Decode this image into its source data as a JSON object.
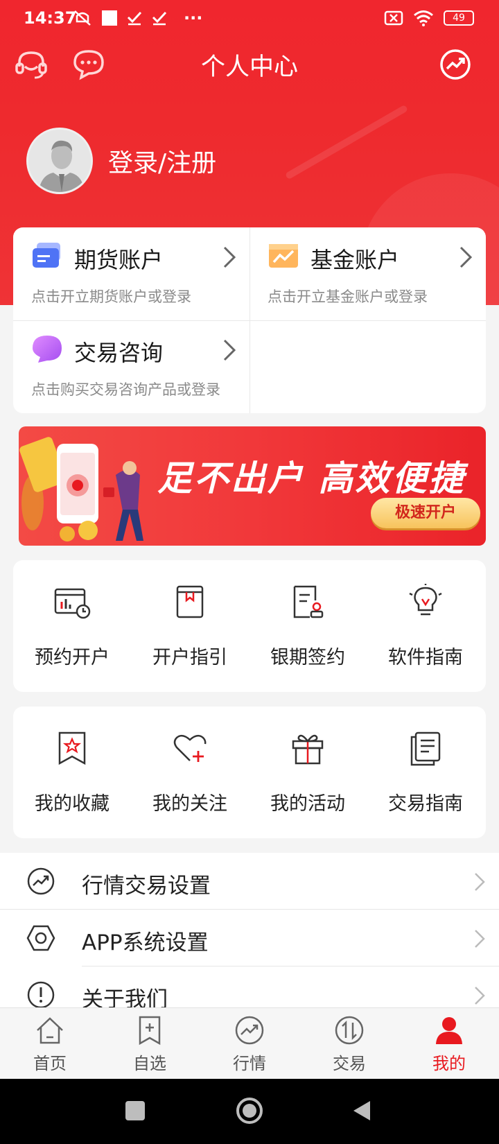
{
  "status_bar": {
    "time": "14:37",
    "dots": "···",
    "battery": "49"
  },
  "header": {
    "title": "个人中心",
    "left_icons": [
      "headset-icon",
      "chat-icon"
    ],
    "right_icon": "market-trend-icon"
  },
  "user": {
    "login_label": "登录/注册"
  },
  "accounts": [
    {
      "name": "期货账户",
      "desc": "点击开立期货账户或登录",
      "icon": "futures-card-icon"
    },
    {
      "name": "基金账户",
      "desc": "点击开立基金账户或登录",
      "icon": "fund-chart-icon"
    },
    {
      "name": "交易咨询",
      "desc": "点击购买交易咨询产品或登录",
      "icon": "consult-bubble-icon"
    }
  ],
  "banner": {
    "slogan": "足不出户  高效便捷",
    "cta": "极速开户"
  },
  "services": [
    {
      "label": "预约开户",
      "icon": "calendar-chart-icon"
    },
    {
      "label": "开户指引",
      "icon": "book-icon"
    },
    {
      "label": "银期签约",
      "icon": "contract-icon"
    },
    {
      "label": "软件指南",
      "icon": "lightbulb-icon"
    }
  ],
  "mine": [
    {
      "label": "我的收藏",
      "icon": "bookmark-star-icon"
    },
    {
      "label": "我的关注",
      "icon": "heart-plus-icon"
    },
    {
      "label": "我的活动",
      "icon": "gift-icon"
    },
    {
      "label": "交易指南",
      "icon": "document-list-icon"
    }
  ],
  "settings": [
    {
      "label": "行情交易设置",
      "icon": "trend-circle-icon"
    },
    {
      "label": "APP系统设置",
      "icon": "hexagon-settings-icon"
    },
    {
      "label": "关于我们",
      "icon": "info-circle-icon"
    }
  ],
  "tabs": [
    {
      "label": "首页",
      "icon": "home-icon",
      "active": false
    },
    {
      "label": "自选",
      "icon": "bookmark-plus-icon",
      "active": false
    },
    {
      "label": "行情",
      "icon": "trend-circle-icon",
      "active": false
    },
    {
      "label": "交易",
      "icon": "exchange-circle-icon",
      "active": false
    },
    {
      "label": "我的",
      "icon": "person-icon",
      "active": true
    }
  ],
  "colors": {
    "brand_red": "#ee2a2e",
    "active_tab": "#e8191f",
    "cta_gold": "#f7c35c"
  }
}
